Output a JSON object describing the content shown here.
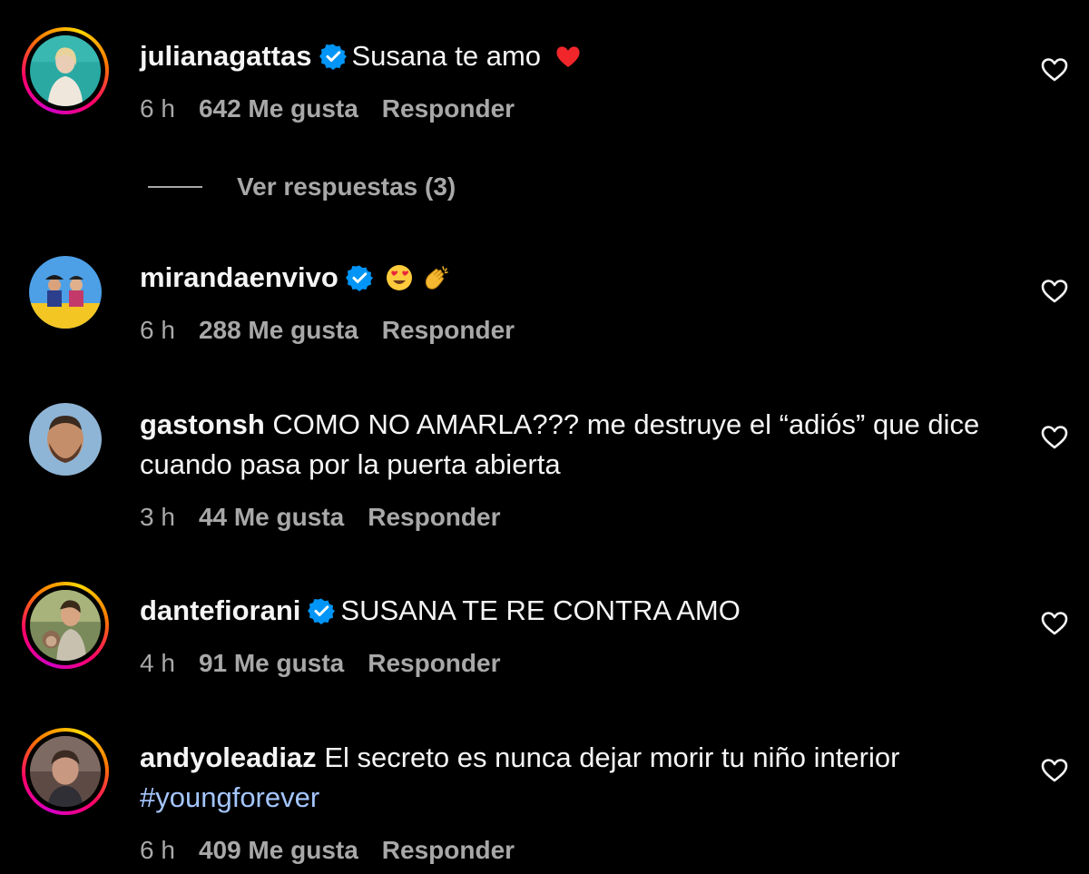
{
  "comments": [
    {
      "username": "julianagattas",
      "verified": true,
      "text": "Susana te amo",
      "emoji": "heart",
      "time": "6 h",
      "likes": "642 Me gusta",
      "reply": "Responder",
      "view_replies": "Ver respuestas (3)",
      "avatar_icon": "avatar-photo-woman"
    },
    {
      "username": "mirandaenvivo",
      "verified": true,
      "text": "",
      "emoji": "heart-eyes-clap",
      "time": "6 h",
      "likes": "288 Me gusta",
      "reply": "Responder",
      "avatar_icon": "avatar-photo-band"
    },
    {
      "username": "gastonsh",
      "verified": false,
      "text": "COMO NO AMARLA??? me destruye el “adiós” que dice cuando pasa por la puerta abierta",
      "time": "3 h",
      "likes": "44 Me gusta",
      "reply": "Responder",
      "avatar_icon": "avatar-photo-man-beard"
    },
    {
      "username": "dantefiorani",
      "verified": true,
      "text": "SUSANA TE RE CONTRA AMO",
      "time": "4 h",
      "likes": "91 Me gusta",
      "reply": "Responder",
      "avatar_icon": "avatar-photo-man-monkey"
    },
    {
      "username": "andyoleadiaz",
      "verified": false,
      "text": "El secreto es nunca dejar morir tu niño interior",
      "hashtag": "#youngforever",
      "time": "6 h",
      "likes": "409 Me gusta",
      "reply": "Responder",
      "avatar_icon": "avatar-photo-man"
    }
  ],
  "colors": {
    "background": "#000000",
    "text": "#f5f5f5",
    "secondary": "#a8a8a8",
    "verified": "#0095f6",
    "hashtag": "#a4c6ff"
  },
  "icons": {
    "like": "heart-outline-icon",
    "verified": "verified-badge-icon"
  }
}
